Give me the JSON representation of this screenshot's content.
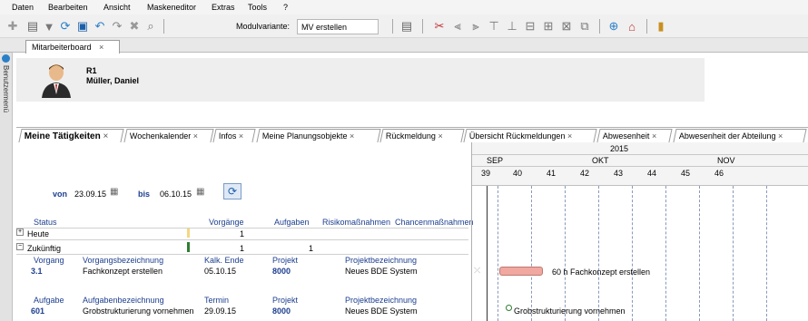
{
  "menu": [
    "Daten",
    "Bearbeiten",
    "Ansicht",
    "Maskeneditor",
    "Extras",
    "Tools",
    "?"
  ],
  "toolbar": {
    "modulvariante_label": "Modulvariante:",
    "modulvariante_value": "MV erstellen"
  },
  "document_tab": {
    "label": "Mitarbeiterboard",
    "close": "×"
  },
  "sidebar": {
    "label": "Benutzermenü"
  },
  "user": {
    "id": "R1",
    "name": "Müller, Daniel"
  },
  "tabs": [
    {
      "label": "Meine Tätigkeiten",
      "close": "×"
    },
    {
      "label": "Wochenkalender",
      "close": "×"
    },
    {
      "label": "Infos",
      "close": "×"
    },
    {
      "label": "Meine Planungsobjekte",
      "close": "×"
    },
    {
      "label": "Rückmeldung",
      "close": "×"
    },
    {
      "label": "Übersicht Rückmeldungen",
      "close": "×"
    },
    {
      "label": "Abwesenheit",
      "close": "×"
    },
    {
      "label": "Abwesenheit der Abteilung",
      "close": "×"
    }
  ],
  "filter": {
    "von_label": "von",
    "von_value": "23.09.15",
    "bis_label": "bis",
    "bis_value": "06.10.15"
  },
  "grid": {
    "headers": {
      "status": "Status",
      "vorgaenge": "Vorgänge",
      "aufgaben": "Aufgaben",
      "risiko": "Risikomaßnahmen",
      "chancen": "Chancenmaßnahmen"
    },
    "rows": [
      {
        "expander": "+",
        "status": "Heute",
        "vorgaenge": "1",
        "aufgaben": "",
        "color": "#f5d77e"
      },
      {
        "expander": "−",
        "status": "Zukünftig",
        "vorgaenge": "1",
        "aufgaben": "1",
        "color": "#2e7d32"
      }
    ],
    "vorgang_headers": {
      "nr": "Vorgang",
      "bez": "Vorgangsbezeichnung",
      "ende": "Kalk. Ende",
      "projekt": "Projekt",
      "projbez": "Projektbezeichnung"
    },
    "vorgang": {
      "nr": "3.1",
      "bez": "Fachkonzept erstellen",
      "ende": "05.10.15",
      "projekt": "8000",
      "projbez": "Neues BDE System"
    },
    "aufgabe_headers": {
      "nr": "Aufgabe",
      "bez": "Aufgabenbezeichnung",
      "termin": "Termin",
      "projekt": "Projekt",
      "projbez": "Projektbezeichnung"
    },
    "aufgabe": {
      "nr": "601",
      "bez": "Grobstrukturierung vornehmen",
      "termin": "29.09.15",
      "projekt": "8000",
      "projbez": "Neues BDE System"
    }
  },
  "gantt": {
    "year": "2015",
    "months": [
      "SEP",
      "OKT",
      "NOV"
    ],
    "weeks": [
      "39",
      "40",
      "41",
      "42",
      "43",
      "44",
      "45",
      "46"
    ],
    "bar_label": "60 h  Fachkonzept erstellen",
    "milestone_label": "Grobstrukturierung vornehmen",
    "bar_color": "#f0a8a0"
  }
}
